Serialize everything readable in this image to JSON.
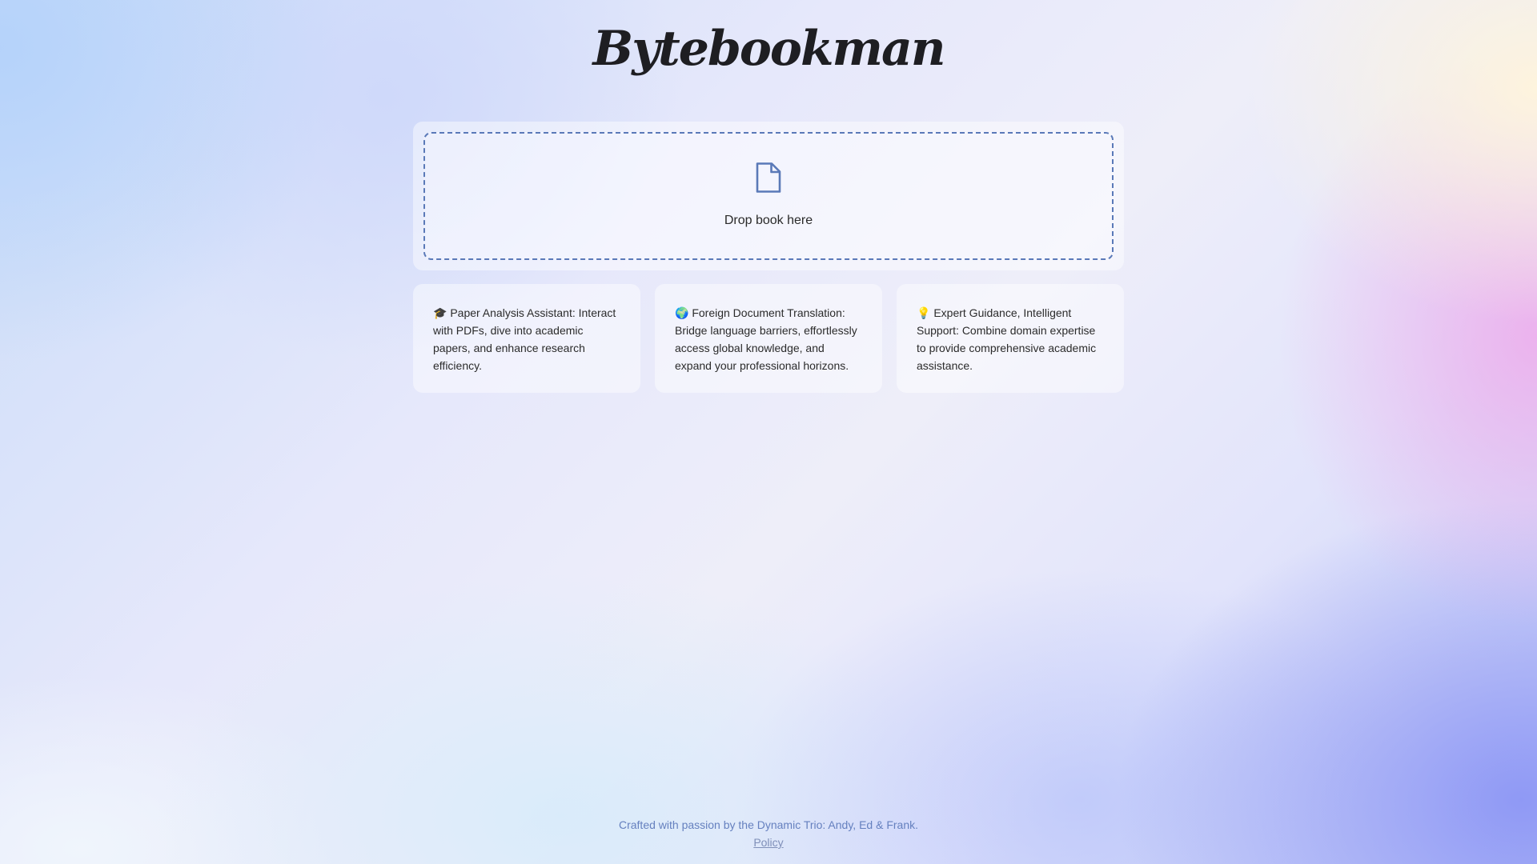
{
  "app": {
    "title": "Bytebookman"
  },
  "upload": {
    "icon": "file-icon",
    "label": "Drop book here",
    "accent_color": "#5a79b8"
  },
  "features": [
    {
      "icon": "graduation-cap-icon",
      "text": "🎓 Paper Analysis Assistant: Interact with PDFs, dive into academic papers, and enhance research efficiency."
    },
    {
      "icon": "globe-icon",
      "text": "🌍 Foreign Document Translation: Bridge language barriers, effortlessly access global knowledge, and expand your professional horizons."
    },
    {
      "icon": "light-bulb-icon",
      "text": "💡 Expert Guidance, Intelligent Support: Combine domain expertise to provide comprehensive academic assistance."
    }
  ],
  "footer": {
    "credit": "Crafted with passion by the Dynamic Trio: Andy, Ed & Frank.",
    "policy_link": "Policy"
  }
}
